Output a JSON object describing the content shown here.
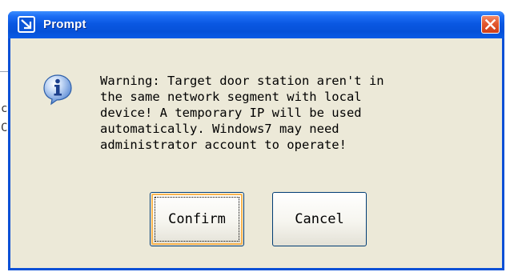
{
  "background_app": {
    "edge_chars": [
      "c",
      "C"
    ]
  },
  "dialog": {
    "title": "Prompt",
    "title_icon": "arrow-down-right-icon",
    "close_icon": "close-icon",
    "info_icon": "information-icon",
    "message": "Warning: Target door station aren't in\nthe same network segment with local\ndevice! A temporary IP will be used\nautomatically. Windows7 may need\nadministrator account to operate!",
    "buttons": {
      "confirm_label": "Confirm",
      "cancel_label": "Cancel"
    }
  },
  "colors": {
    "titlebar": "#0a58e2",
    "client_background": "#ece9d8",
    "close_button": "#e2582f",
    "default_button_focus": "#f8b450"
  }
}
